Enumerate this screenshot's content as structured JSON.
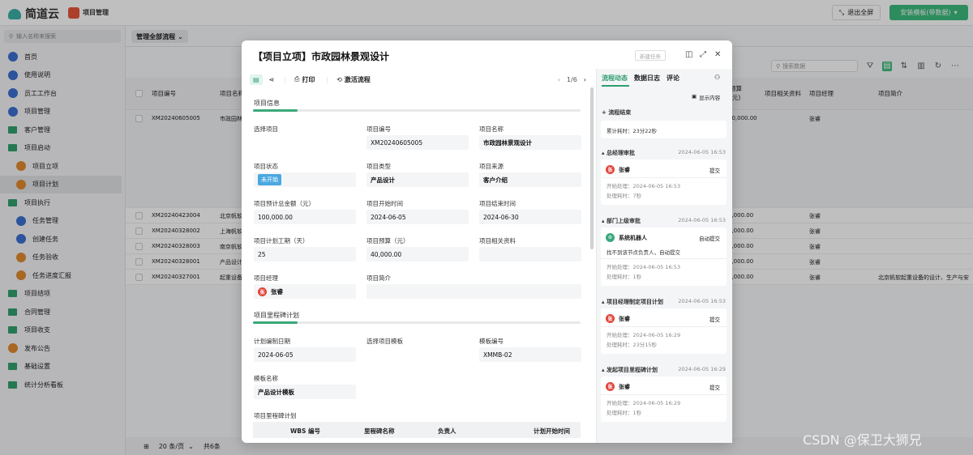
{
  "topbar": {
    "logo_text": "简道云",
    "app_name": "项目管理",
    "exit_fullscreen": "退出全屏",
    "install_template": "安装模板(带数据)"
  },
  "sidebar": {
    "search_placeholder": "输入名称来搜索",
    "items": [
      {
        "label": "首页",
        "type": "circle",
        "color": "#3b6fd1",
        "indent": 0
      },
      {
        "label": "使用说明",
        "type": "circle",
        "color": "#3b6fd1",
        "indent": 0
      },
      {
        "label": "员工工作台",
        "type": "circle",
        "color": "#3b6fd1",
        "indent": 0
      },
      {
        "label": "项目管理",
        "type": "circle",
        "color": "#3b6fd1",
        "indent": 0
      },
      {
        "label": "客户管理",
        "type": "folder",
        "color": "#33a06e",
        "indent": 0
      },
      {
        "label": "项目启动",
        "type": "folder",
        "color": "#33a06e",
        "indent": 0
      },
      {
        "label": "项目立项",
        "type": "circle",
        "color": "#e08a2f",
        "indent": 1
      },
      {
        "label": "项目计划",
        "type": "circle",
        "color": "#e08a2f",
        "indent": 1,
        "active": true
      },
      {
        "label": "项目执行",
        "type": "folder",
        "color": "#33a06e",
        "indent": 0
      },
      {
        "label": "任务管理",
        "type": "circle",
        "color": "#3b6fd1",
        "indent": 1
      },
      {
        "label": "创建任务",
        "type": "circle",
        "color": "#3b6fd1",
        "indent": 1
      },
      {
        "label": "任务验收",
        "type": "circle",
        "color": "#e08a2f",
        "indent": 1
      },
      {
        "label": "任务进度汇报",
        "type": "circle",
        "color": "#e08a2f",
        "indent": 1
      },
      {
        "label": "项目结项",
        "type": "folder",
        "color": "#33a06e",
        "indent": 0
      },
      {
        "label": "合同管理",
        "type": "folder",
        "color": "#33a06e",
        "indent": 0
      },
      {
        "label": "项目收支",
        "type": "folder",
        "color": "#33a06e",
        "indent": 0
      },
      {
        "label": "发布公告",
        "type": "circle",
        "color": "#e08a2f",
        "indent": 0
      },
      {
        "label": "基础设置",
        "type": "folder",
        "color": "#33a06e",
        "indent": 0
      },
      {
        "label": "统计分析看板",
        "type": "folder",
        "color": "#33a06e",
        "indent": 0
      }
    ]
  },
  "main": {
    "view_label": "管理全部流程",
    "search_placeholder": "搜索数据",
    "columns": [
      "项目编号",
      "项目名称",
      "预算\n(元)",
      "项目相关资料",
      "项目经理",
      "项目简介"
    ],
    "rows": [
      {
        "code": "XM20240605005",
        "name": "市政园林",
        "budget": "40,000.00",
        "manager": "张睿",
        "intro": ""
      },
      {
        "code": "XM20240423004",
        "name": "北京帆软",
        "budget": "8,000.00",
        "manager": "张睿",
        "intro": ""
      },
      {
        "code": "XM20240328002",
        "name": "上海帆软",
        "budget": "9,000.00",
        "manager": "张睿",
        "intro": ""
      },
      {
        "code": "XM20240328003",
        "name": "南京帆软",
        "budget": "9,000.00",
        "manager": "张睿",
        "intro": ""
      },
      {
        "code": "XM20240328001",
        "name": "产品设计",
        "budget": "5,000.00",
        "manager": "张睿",
        "intro": ""
      },
      {
        "code": "XM20240327001",
        "name": "起重设备",
        "budget": "0,000.00",
        "manager": "张睿",
        "intro": "北京帆软起重设备的设计、生产与安"
      }
    ],
    "page_size": "20 条/页",
    "total": "共6条"
  },
  "modal": {
    "title": "【项目立项】市政园林景观设计",
    "new_task": "新建任务",
    "print": "打印",
    "activate_flow": "激活流程",
    "pager": "1/6",
    "section_info": "项目信息",
    "f_select_project": "选择项目",
    "f_project_code": "项目编号",
    "v_project_code": "XM20240605005",
    "f_project_name": "项目名称",
    "v_project_name": "市政园林景观设计",
    "f_status": "项目状态",
    "v_status": "未开始",
    "f_type": "项目类型",
    "v_type": "产品设计",
    "f_source": "项目来源",
    "v_source": "客户介绍",
    "f_total": "项目预计总金额（元）",
    "v_total": "100,000.00",
    "f_start": "项目开始时间",
    "v_start": "2024-06-05",
    "f_end": "项目结束时间",
    "v_end": "2024-06-30",
    "f_period": "项目计划工期（天）",
    "v_period": "25",
    "f_budget": "项目预算（元）",
    "v_budget": "40,000.00",
    "f_materials": "项目相关资料",
    "f_manager": "项目经理",
    "v_manager": "张睿",
    "avatar_char": "张",
    "f_intro": "项目简介",
    "section_milestone": "项目里程碑计划",
    "f_plan_date": "计划编制日期",
    "v_plan_date": "2024-06-05",
    "f_select_template": "选择项目模板",
    "f_template_code": "模板编号",
    "v_template_code": "XMMB-02",
    "f_template_name": "模板名称",
    "v_template_name": "产品设计模板",
    "f_milestone_plan": "项目里程碑计划",
    "ms_columns": [
      "WBS 编号",
      "里程碑名称",
      "负责人",
      "计划开始时间"
    ]
  },
  "flow": {
    "tabs": [
      "流程动态",
      "数据日志",
      "评论"
    ],
    "show_content": "显示内容",
    "end_label": "流程结束",
    "total_time": "累计耗时：23分22秒",
    "stages": [
      {
        "name": "总经理审批",
        "time": "2024-06-05 16:53",
        "who": "张睿",
        "action": "提交",
        "msg": "",
        "start": "开始处理：2024-06-05 16:53",
        "took": "处理耗时：7秒"
      },
      {
        "name": "部门上级审批",
        "time": "2024-06-05 16:53",
        "who": "系统机器人",
        "action": "自动提交",
        "msg": "找不到该节点负责人，自动提交",
        "start": "开始处理：2024-06-05 16:53",
        "took": "处理耗时：1秒"
      },
      {
        "name": "项目经理制定项目计划",
        "time": "2024-06-05 16:53",
        "who": "张睿",
        "action": "提交",
        "msg": "",
        "start": "开始处理：2024-06-05 16:29",
        "took": "处理耗时：23分15秒"
      },
      {
        "name": "发起项目里程碑计划",
        "time": "2024-06-05 16:29",
        "who": "张睿",
        "action": "提交",
        "msg": "",
        "start": "开始处理：2024-06-05 16:29",
        "took": "处理耗时：1秒"
      }
    ]
  },
  "watermark": "CSDN @保卫大狮兄"
}
